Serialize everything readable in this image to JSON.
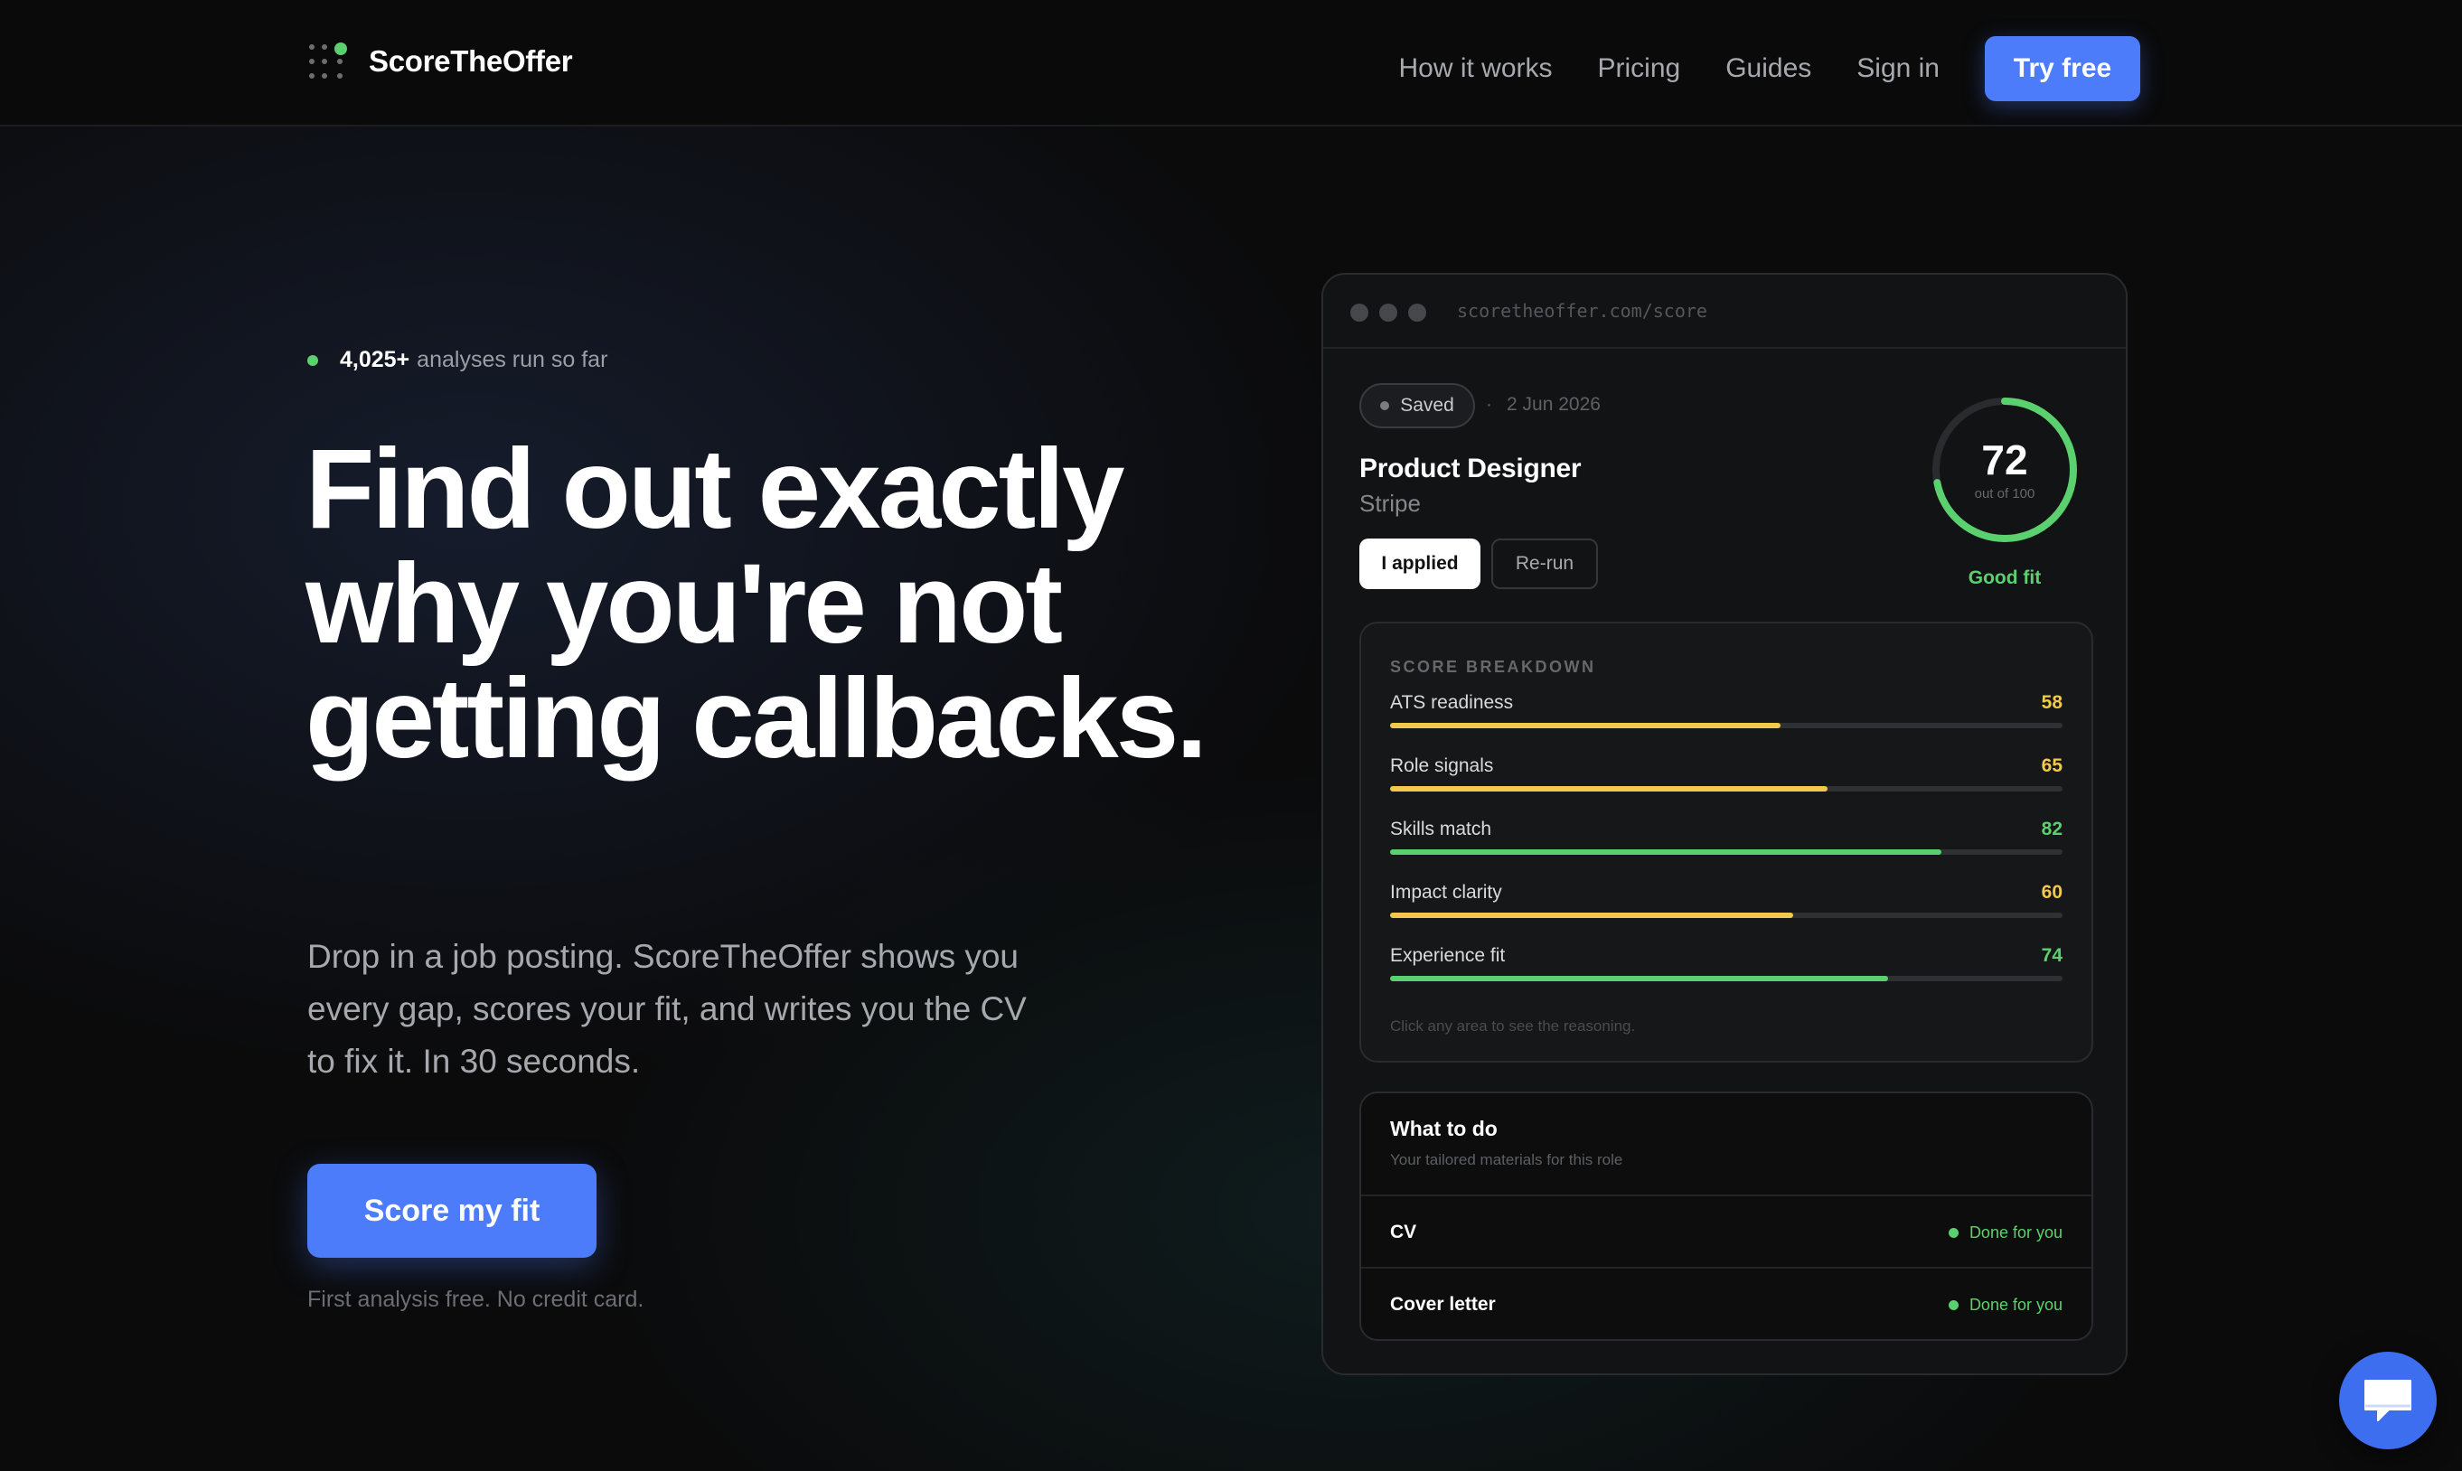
{
  "nav": {
    "brand": "ScoreTheOffer",
    "links": [
      "How it works",
      "Pricing",
      "Guides",
      "Sign in"
    ],
    "cta": "Try free"
  },
  "hero": {
    "stat_number": "4,025+",
    "stat_text": "analyses run so far",
    "headline": "Find out exactly why you're not getting callbacks.",
    "subheadline": "Drop in a job posting. ScoreTheOffer shows you every gap, scores your fit, and writes you the CV to fix it. In 30 seconds.",
    "cta": "Score my fit",
    "note": "First analysis free. No credit card."
  },
  "preview": {
    "url": "scoretheoffer.com/score",
    "saved_label": "Saved",
    "date": "2 Jun 2026",
    "job_title": "Product Designer",
    "company": "Stripe",
    "applied_label": "I applied",
    "rerun_label": "Re-run",
    "score": 72,
    "score_sub": "out of 100",
    "fit_label": "Good fit",
    "breakdown": {
      "title": "SCORE BREAKDOWN",
      "metrics": [
        {
          "label": "ATS readiness",
          "value": 58,
          "color": "#f2c94c"
        },
        {
          "label": "Role signals",
          "value": 65,
          "color": "#f2c94c"
        },
        {
          "label": "Skills match",
          "value": 82,
          "color": "#5ad16e"
        },
        {
          "label": "Impact clarity",
          "value": 60,
          "color": "#f2c94c"
        },
        {
          "label": "Experience fit",
          "value": 74,
          "color": "#5ad16e"
        }
      ],
      "hint": "Click any area to see the reasoning."
    },
    "todo": {
      "title": "What to do",
      "subtitle": "Your tailored materials for this role",
      "rows": [
        {
          "label": "CV",
          "status": "Done for you"
        },
        {
          "label": "Cover letter",
          "status": "Done for you"
        }
      ]
    }
  },
  "colors": {
    "accent": "#4d7cfb",
    "green": "#5ad16e",
    "yellow": "#f2c94c",
    "background": "#0b0b0c"
  }
}
